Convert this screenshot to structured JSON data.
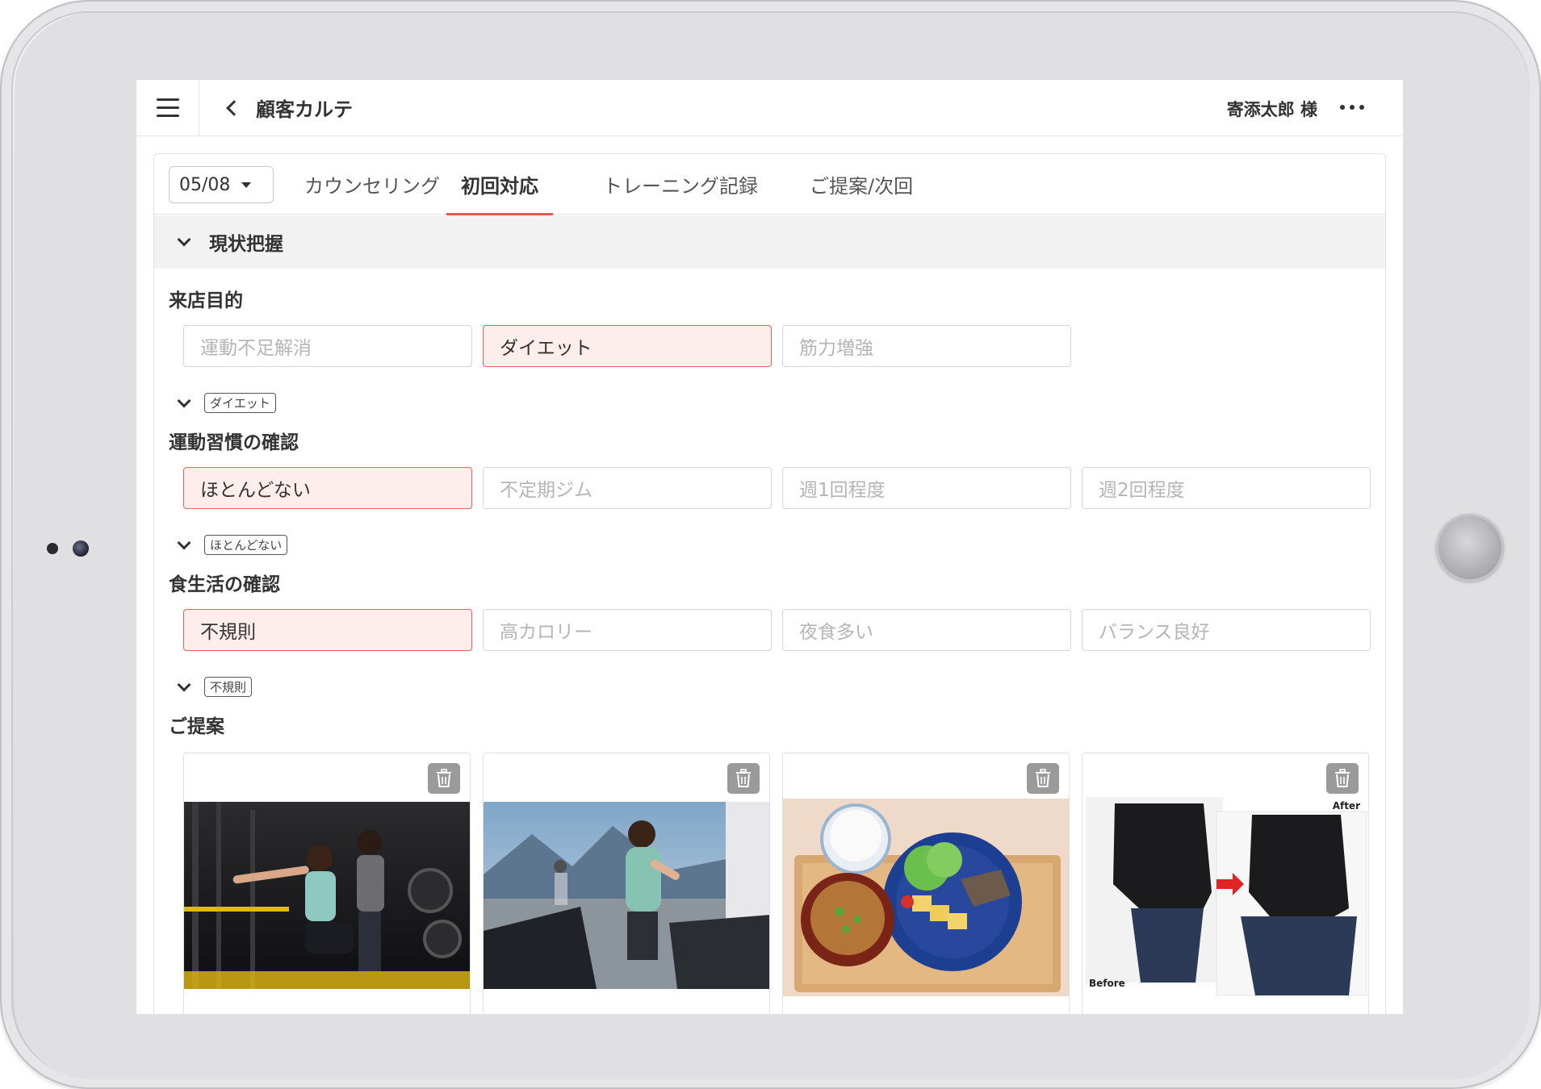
{
  "header": {
    "title": "顧客カルテ",
    "customer_name": "寄添太郎 様"
  },
  "tabs": {
    "date": "05/08",
    "items": [
      {
        "label": "カウンセリング",
        "active": false
      },
      {
        "label": "初回対応",
        "active": true
      },
      {
        "label": "トレーニング記録",
        "active": false
      },
      {
        "label": "ご提案/次回",
        "active": false
      }
    ]
  },
  "section": {
    "title": "現状把握"
  },
  "visit_purpose": {
    "label": "来店目的",
    "options": [
      {
        "label": "運動不足解消",
        "selected": false
      },
      {
        "label": "ダイエット",
        "selected": true
      },
      {
        "label": "筋力増強",
        "selected": false
      }
    ],
    "tag": "ダイエット"
  },
  "exercise_habit": {
    "label": "運動習慣の確認",
    "options": [
      {
        "label": "ほとんどない",
        "selected": true
      },
      {
        "label": "不定期ジム",
        "selected": false
      },
      {
        "label": "週1回程度",
        "selected": false
      },
      {
        "label": "週2回程度",
        "selected": false
      }
    ],
    "tag": "ほとんどない"
  },
  "diet_habit": {
    "label": "食生活の確認",
    "options": [
      {
        "label": "不規則",
        "selected": true
      },
      {
        "label": "高カロリー",
        "selected": false
      },
      {
        "label": "夜食多い",
        "selected": false
      },
      {
        "label": "バランス良好",
        "selected": false
      }
    ],
    "tag": "不規則"
  },
  "proposals": {
    "label": "ご提案",
    "cards": [
      {
        "image": "trainer-guided-squat-photo",
        "caption": ""
      },
      {
        "image": "treadmill-running-photo",
        "caption": ""
      },
      {
        "image": "balanced-meal-photo",
        "caption": ""
      },
      {
        "image": "before-after-weight-loss-photo",
        "before_label": "Before",
        "after_label": "After",
        "caption": ""
      }
    ]
  },
  "colors": {
    "accent": "#e85a4f",
    "selected_bg": "#fdeeec",
    "muted_text": "#b5b5b5"
  }
}
